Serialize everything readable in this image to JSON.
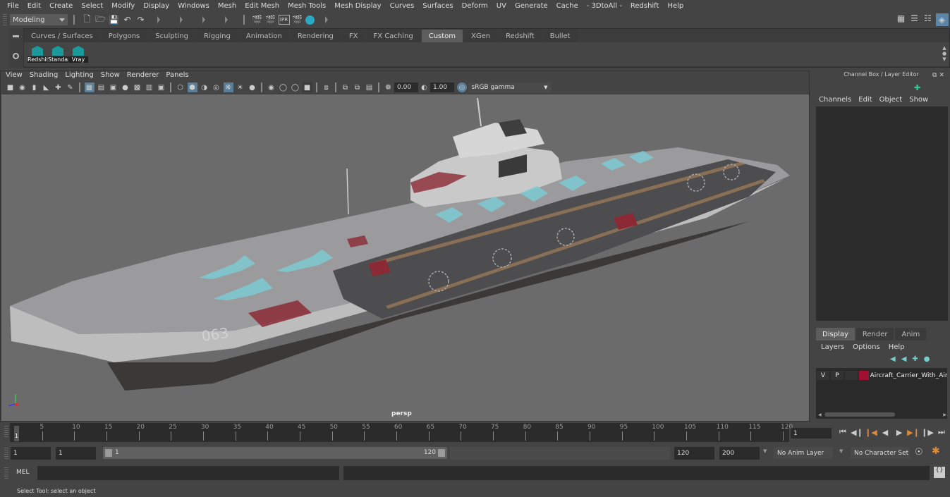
{
  "menubar": [
    "File",
    "Edit",
    "Create",
    "Select",
    "Modify",
    "Display",
    "Windows",
    "Mesh",
    "Edit Mesh",
    "Mesh Tools",
    "Mesh Display",
    "Curves",
    "Surfaces",
    "Deform",
    "UV",
    "Generate",
    "Cache",
    "- 3DtoAll -",
    "Redshift",
    "Help"
  ],
  "status_line": {
    "mode": "Modeling",
    "icons": [
      "new-scene-icon",
      "open-scene-icon",
      "save-scene-icon",
      "undo-icon",
      "redo-icon"
    ],
    "render_icons": [
      "render-view-icon",
      "render-current-frame-icon",
      "ipr-render-icon",
      "render-settings-icon",
      "hypershade-icon"
    ],
    "right_icons": [
      "modeling-toolkit-icon",
      "attribute-editor-icon",
      "tool-settings-icon",
      "channel-box-icon"
    ]
  },
  "shelf": {
    "tabs": [
      "Curves / Surfaces",
      "Polygons",
      "Sculpting",
      "Rigging",
      "Animation",
      "Rendering",
      "FX",
      "FX Caching",
      "Custom",
      "XGen",
      "Redshift",
      "Bullet"
    ],
    "active_tab": "Custom",
    "buttons": [
      "Redshif",
      "Standar",
      "Vray"
    ]
  },
  "viewport": {
    "menu": [
      "View",
      "Shading",
      "Lighting",
      "Show",
      "Renderer",
      "Panels"
    ],
    "exposure": "0.00",
    "gamma": "1.00",
    "color_space": "sRGB gamma",
    "camera_label": "persp",
    "model": {
      "hull_number": "063",
      "accent": "#8b2a35",
      "jet_color": "#7fc8cf"
    }
  },
  "channel_box": {
    "title": "Channel Box / Layer Editor",
    "menu": [
      "Channels",
      "Edit",
      "Object",
      "Show"
    ]
  },
  "layer_editor": {
    "tabs": [
      "Display",
      "Render",
      "Anim"
    ],
    "active_tab": "Display",
    "menu": [
      "Layers",
      "Options",
      "Help"
    ],
    "layers": [
      {
        "visible": "V",
        "playback": "P",
        "color": "#a01030",
        "name": "Aircraft_Carrier_With_Air"
      }
    ]
  },
  "timeline": {
    "ticks": [
      "5",
      "10",
      "15",
      "20",
      "25",
      "30",
      "35",
      "40",
      "45",
      "50",
      "55",
      "60",
      "65",
      "70",
      "75",
      "80",
      "85",
      "90",
      "95",
      "100",
      "105",
      "110",
      "115",
      "120"
    ],
    "current_frame_marker": "1",
    "current_frame": "1"
  },
  "range": {
    "start": "1",
    "playback_start": "1",
    "slider_start": "1",
    "slider_end": "120",
    "playback_end": "120",
    "end": "200",
    "anim_layer": "No Anim Layer",
    "character_set": "No Character Set"
  },
  "command_line": {
    "label": "MEL",
    "value": ""
  },
  "help_line": "Select Tool: select an object"
}
